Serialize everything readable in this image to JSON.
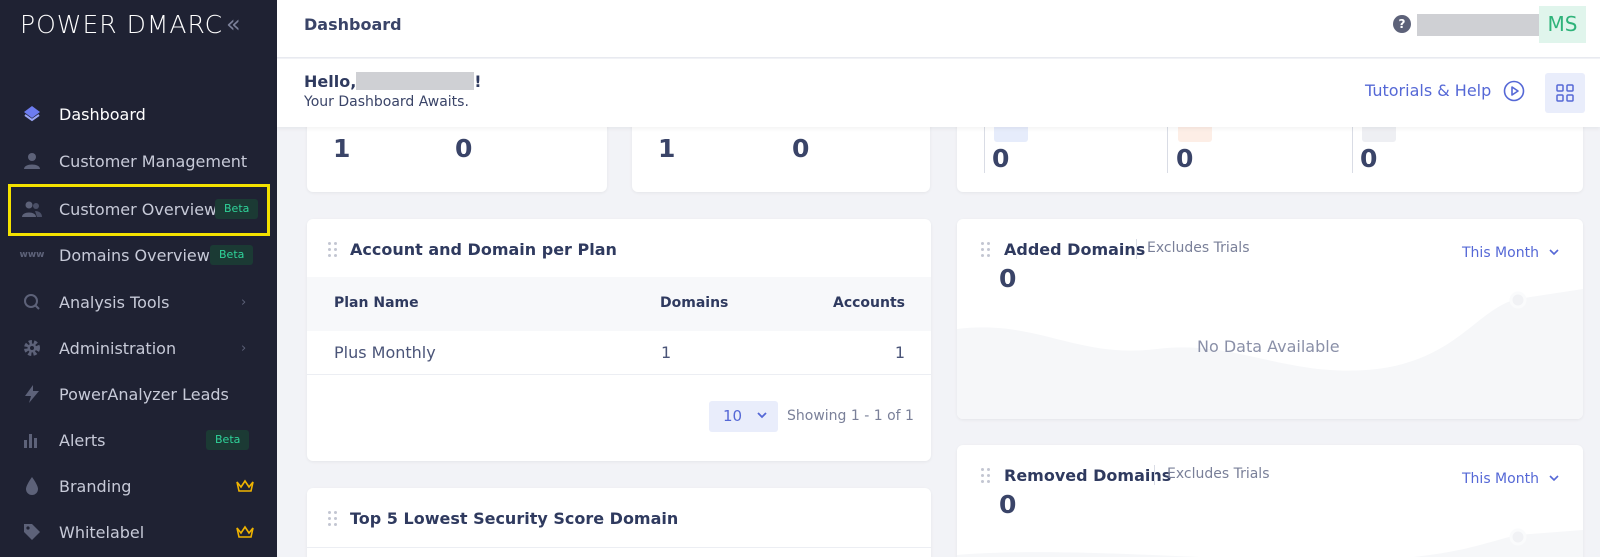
{
  "sidebar": {
    "logo": "POWER DMARC",
    "items": [
      {
        "label": "Dashboard",
        "icon": "layers-icon"
      },
      {
        "label": "Customer Management",
        "icon": "user-icon"
      },
      {
        "label": "Customer Overview",
        "icon": "users-icon",
        "badge": "Beta"
      },
      {
        "label": "Domains Overview",
        "icon": "www-icon",
        "badge": "Beta"
      },
      {
        "label": "Analysis Tools",
        "icon": "search-icon"
      },
      {
        "label": "Administration",
        "icon": "gear-icon"
      },
      {
        "label": "PowerAnalyzer Leads",
        "icon": "bolt-icon"
      },
      {
        "label": "Alerts",
        "icon": "bar-chart-icon",
        "badge": "Beta"
      },
      {
        "label": "Branding",
        "icon": "drop-icon"
      },
      {
        "label": "Whitelabel",
        "icon": "tag-icon"
      }
    ]
  },
  "topbar": {
    "title": "Dashboard",
    "help": "?",
    "avatar_initials": "MS"
  },
  "greeting": {
    "hello": "Hello,",
    "hello_suffix": "!",
    "subtitle": "Your Dashboard Awaits.",
    "tutorials_label": "Tutorials & Help"
  },
  "summary_cards": {
    "card1": [
      "1",
      "0"
    ],
    "card2": [
      "1",
      "0"
    ],
    "card3": [
      "0",
      "0",
      "0"
    ]
  },
  "plan_table": {
    "title": "Account and Domain per Plan",
    "columns": [
      "Plan Name",
      "Domains",
      "Accounts"
    ],
    "rows": [
      {
        "plan": "Plus Monthly",
        "domains": "1",
        "accounts": "1"
      }
    ],
    "page_size": "10",
    "showing": "Showing 1 - 1 of 1"
  },
  "added_domains": {
    "title": "Added Domains",
    "note": "Excludes Trials",
    "period": "This Month",
    "value": "0",
    "empty": "No Data Available"
  },
  "removed_domains": {
    "title": "Removed Domains",
    "note": "Excludes Trials",
    "period": "This Month",
    "value": "0"
  },
  "lowest_security": {
    "title": "Top 5 Lowest Security Score Domain"
  },
  "colors": {
    "sidebar_bg": "#1f2233",
    "accent": "#5568d6",
    "beta_badge": "#2fd39a",
    "highlight": "#f4e200"
  }
}
